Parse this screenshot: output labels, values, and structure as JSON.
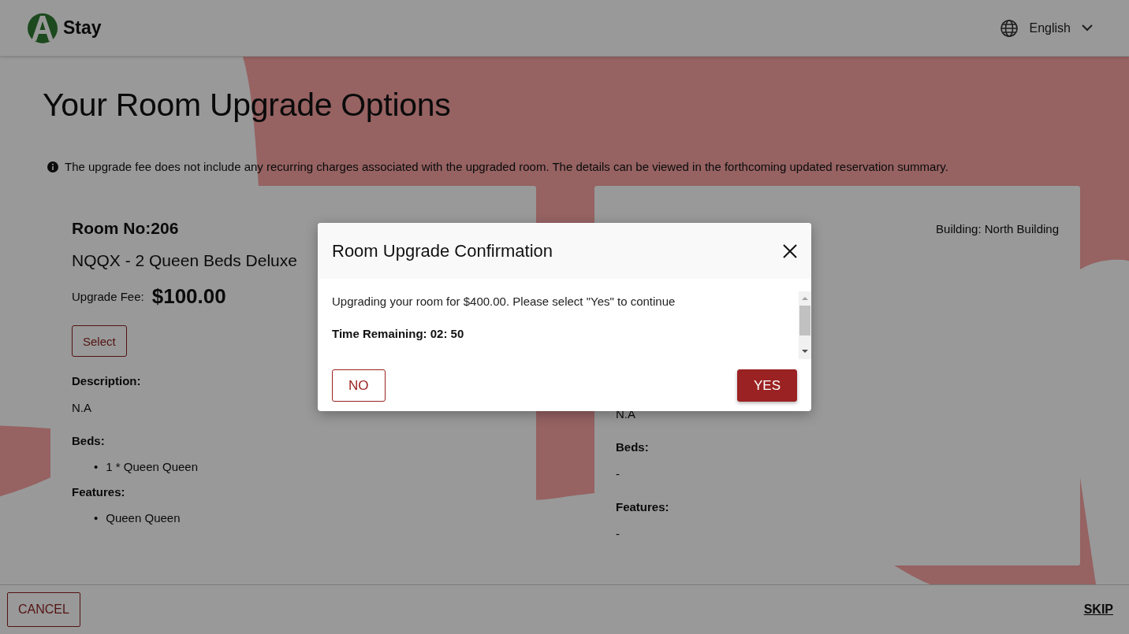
{
  "header": {
    "brand": "Stay",
    "language": "English"
  },
  "page": {
    "title": "Your Room Upgrade Options",
    "notice": "The upgrade fee does not include any recurring charges associated with the upgraded room. The details can be viewed in the forthcoming updated reservation summary."
  },
  "rooms": [
    {
      "room_no": "Room No:206",
      "name": "NQQX - 2 Queen Beds Deluxe",
      "fee_label": "Upgrade Fee:",
      "fee": "$100.00",
      "select_label": "Select",
      "description_label": "Description:",
      "description": "N.A",
      "beds_label": "Beds:",
      "beds": [
        "1 * Queen Queen"
      ],
      "features_label": "Features:",
      "features": [
        "Queen Queen"
      ],
      "list_marker": "•"
    },
    {
      "building": "Building: North Building",
      "description": "N.A",
      "beds_label": "Beds:",
      "beds_empty": "-",
      "features_label": "Features:",
      "features_empty": "-"
    }
  ],
  "dialog": {
    "title": "Room Upgrade Confirmation",
    "message": "Upgrading your room for $400.00. Please select \"Yes\" to continue",
    "timer": "Time Remaining: 02: 50",
    "buttons": [
      {
        "label": "NO",
        "kind": "secondary"
      },
      {
        "label": "YES",
        "kind": "primary"
      }
    ]
  },
  "footer": {
    "cancel": "CANCEL",
    "skip": "SKIP"
  }
}
